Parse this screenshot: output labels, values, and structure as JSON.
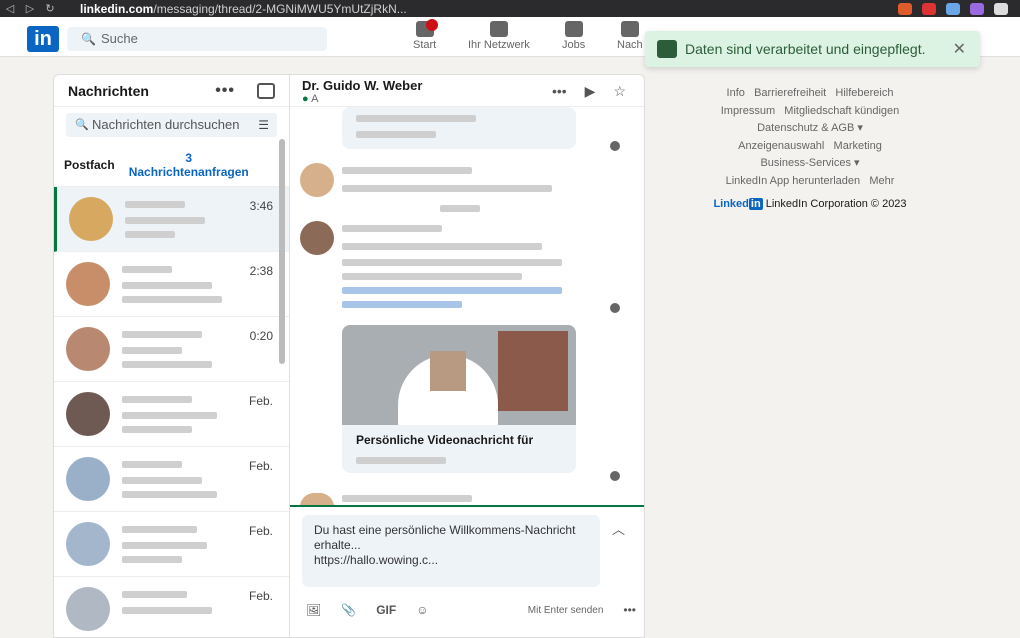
{
  "browser": {
    "url_domain": "linkedin.com",
    "url_path": "/messaging/thread/2-MGNiMWU5YmUtZjRkN..."
  },
  "nav": {
    "logo": "in",
    "search_placeholder": "Suche",
    "items": [
      {
        "label": "Start"
      },
      {
        "label": "Ihr Netzwerk"
      },
      {
        "label": "Jobs"
      },
      {
        "label": "Nach"
      }
    ]
  },
  "toast": {
    "text": "Daten sind verarbeitet und eingepflegt.",
    "close": "✕"
  },
  "messaging": {
    "title": "Nachrichten",
    "more": "•••",
    "search_placeholder": "Nachrichten durchsuchen",
    "tab_inbox": "Postfach",
    "tab_requests_count": "3",
    "tab_requests_label": "Nachrichtenanfragen",
    "conversations": [
      {
        "time": "3:46"
      },
      {
        "time": "2:38"
      },
      {
        "time": "0:20"
      },
      {
        "time": "Feb."
      },
      {
        "time": "Feb."
      },
      {
        "time": "Feb."
      },
      {
        "time": "Feb."
      }
    ]
  },
  "thread": {
    "contact_name": "Dr. Guido W. Weber",
    "status": "A",
    "video_title": "Persönliche Videonachricht für",
    "compose_text": "Du hast eine persönliche Willkommens-Nachricht erhalte...\nhttps://hallo.wowing.c...",
    "toolbar": {
      "gif": "GIF",
      "send_hint": "Mit Enter senden",
      "more": "•••"
    }
  },
  "footer": {
    "links": [
      [
        "Info",
        "Barrierefreiheit",
        "Hilfebereich"
      ],
      [
        "Impressum",
        "Mitgliedschaft kündigen"
      ],
      [
        "Datenschutz & AGB ▾"
      ],
      [
        "Anzeigenauswahl",
        "Marketing"
      ],
      [
        "Business-Services ▾"
      ],
      [
        "LinkedIn App herunterladen",
        "Mehr"
      ]
    ],
    "brand_logo": "Linked",
    "brand_text": "LinkedIn Corporation © 2023"
  }
}
